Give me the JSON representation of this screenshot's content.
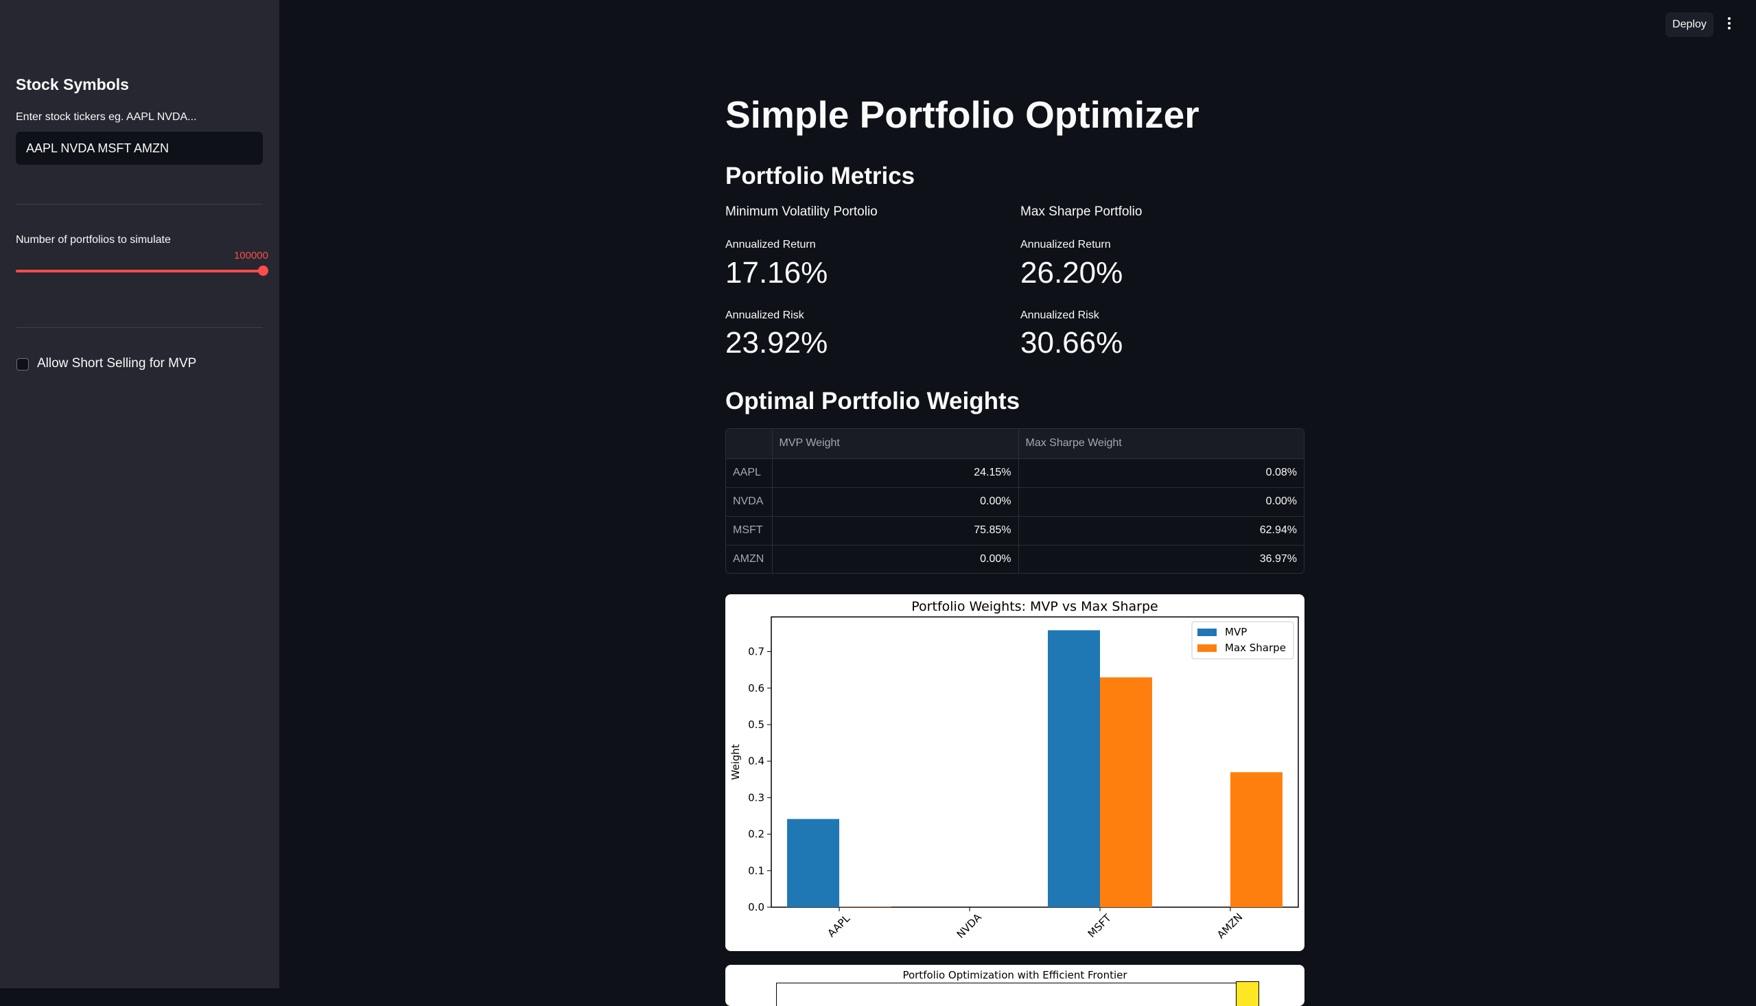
{
  "sidebar": {
    "heading": "Stock Symbols",
    "ticker_label": "Enter stock tickers eg. AAPL NVDA...",
    "ticker_value": "AAPL NVDA MSFT AMZN",
    "portfolios_label": "Number of portfolios to simulate",
    "portfolios_value": "100000",
    "short_selling_label": "Allow Short Selling for MVP",
    "short_selling_checked": false
  },
  "header": {
    "deploy_label": "Deploy"
  },
  "main": {
    "title": "Simple Portfolio Optimizer",
    "metrics_heading": "Portfolio Metrics",
    "mvp": {
      "name": "Minimum Volatility Portolio",
      "return_label": "Annualized Return",
      "return_value": "17.16%",
      "risk_label": "Annualized Risk",
      "risk_value": "23.92%"
    },
    "max_sharpe": {
      "name": "Max Sharpe Portfolio",
      "return_label": "Annualized Return",
      "return_value": "26.20%",
      "risk_label": "Annualized Risk",
      "risk_value": "30.66%"
    },
    "weights_heading": "Optimal Portfolio Weights",
    "table": {
      "columns": [
        "",
        "MVP Weight",
        "Max Sharpe Weight"
      ],
      "rows": [
        [
          "AAPL",
          "24.15%",
          "0.08%"
        ],
        [
          "NVDA",
          "0.00%",
          "0.00%"
        ],
        [
          "MSFT",
          "75.85%",
          "62.94%"
        ],
        [
          "AMZN",
          "0.00%",
          "36.97%"
        ]
      ]
    },
    "second_chart_title": "Portfolio Optimization with Efficient Frontier"
  },
  "chart_data": {
    "type": "bar",
    "title": "Portfolio Weights: MVP vs Max Sharpe",
    "xlabel": "",
    "ylabel": "Weight",
    "categories": [
      "AAPL",
      "NVDA",
      "MSFT",
      "AMZN"
    ],
    "series": [
      {
        "name": "MVP",
        "values": [
          0.2415,
          0.0,
          0.7585,
          0.0
        ],
        "color": "#1f77b4"
      },
      {
        "name": "Max Sharpe",
        "values": [
          0.0008,
          0.0,
          0.6294,
          0.3697
        ],
        "color": "#ff7f0e"
      }
    ],
    "ylim": [
      0,
      0.795
    ],
    "yticks": [
      "0.0",
      "0.1",
      "0.2",
      "0.3",
      "0.4",
      "0.5",
      "0.6",
      "0.7"
    ],
    "legend": "top-right",
    "grid": false
  }
}
